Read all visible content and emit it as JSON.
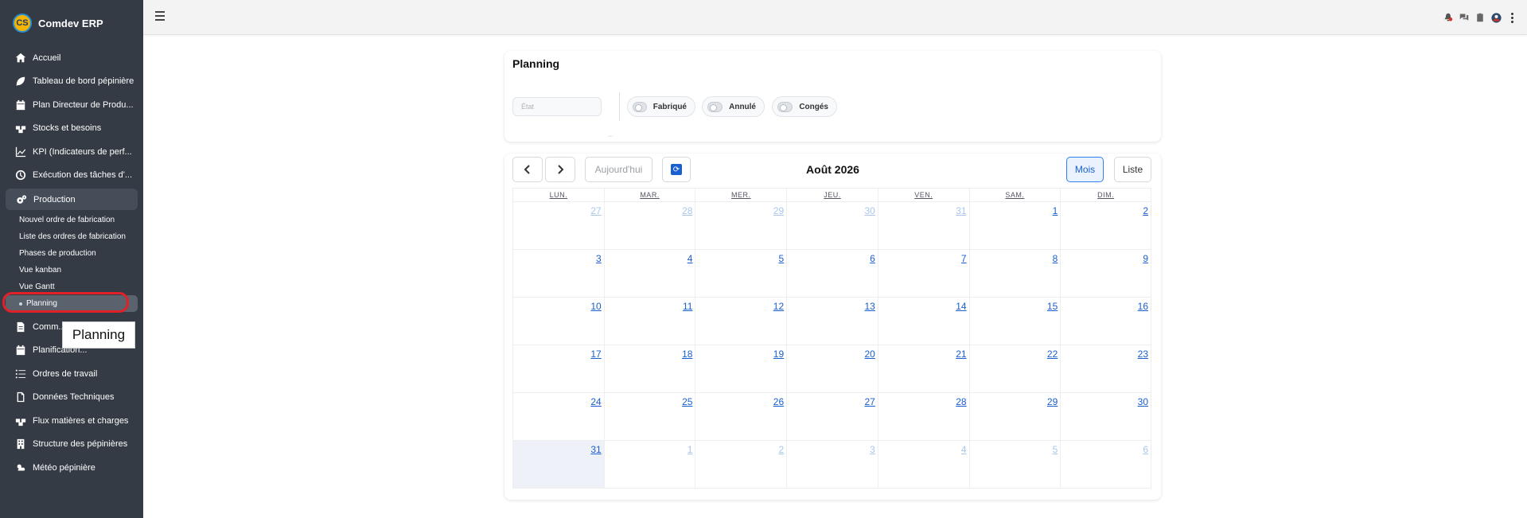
{
  "app": {
    "name": "Comdev ERP",
    "logo_text": "CS"
  },
  "sidebar": {
    "items": [
      {
        "label": "Accueil",
        "icon": "home-icon"
      },
      {
        "label": "Tableau de bord pépinière",
        "icon": "leaf-icon"
      },
      {
        "label": "Plan Directeur de Produ...",
        "icon": "calendar-icon"
      },
      {
        "label": "Stocks et besoins",
        "icon": "boxes-icon"
      },
      {
        "label": "KPI (Indicateurs de perf...",
        "icon": "chart-line-icon"
      },
      {
        "label": "Exécution des tâches d'...",
        "icon": "clock-icon"
      },
      {
        "label": "Production",
        "icon": "cogs-icon"
      }
    ],
    "production_sub": [
      {
        "label": "Nouvel ordre de fabrication"
      },
      {
        "label": "Liste des ordres de fabrication"
      },
      {
        "label": "Phases de production"
      },
      {
        "label": "Vue kanban"
      },
      {
        "label": "Vue Gantt"
      },
      {
        "label": "Planning"
      }
    ],
    "items_after": [
      {
        "label": "Comm...",
        "icon": "file-icon"
      },
      {
        "label": "Planification...",
        "icon": "calendar-icon"
      },
      {
        "label": "Ordres de travail",
        "icon": "list-icon"
      },
      {
        "label": "Données Techniques",
        "icon": "document-icon"
      },
      {
        "label": "Flux matières et charges",
        "icon": "boxes-icon"
      },
      {
        "label": "Structure des pépinières",
        "icon": "building-icon"
      },
      {
        "label": "Météo pépinière",
        "icon": "weather-icon"
      }
    ]
  },
  "tooltip": {
    "text": "Planning"
  },
  "filters": {
    "title": "Planning",
    "etat_placeholder": "État",
    "toggles": [
      {
        "label": "Fabriqué",
        "checked": false
      },
      {
        "label": "Annulé",
        "checked": false
      },
      {
        "label": "Congés",
        "checked": false
      }
    ]
  },
  "calendar": {
    "title": "Août 2026",
    "today_label": "Aujourd'hui",
    "view_month": "Mois",
    "view_list": "Liste",
    "days_of_week": [
      "LUN.",
      "MAR.",
      "MER.",
      "JEU.",
      "VEN.",
      "SAM.",
      "DIM."
    ],
    "weeks": [
      [
        {
          "d": "27",
          "o": true
        },
        {
          "d": "28",
          "o": true
        },
        {
          "d": "29",
          "o": true
        },
        {
          "d": "30",
          "o": true
        },
        {
          "d": "31",
          "o": true
        },
        {
          "d": "1",
          "o": false
        },
        {
          "d": "2",
          "o": false
        }
      ],
      [
        {
          "d": "3",
          "o": false
        },
        {
          "d": "4",
          "o": false
        },
        {
          "d": "5",
          "o": false
        },
        {
          "d": "6",
          "o": false
        },
        {
          "d": "7",
          "o": false
        },
        {
          "d": "8",
          "o": false
        },
        {
          "d": "9",
          "o": false
        }
      ],
      [
        {
          "d": "10",
          "o": false
        },
        {
          "d": "11",
          "o": false
        },
        {
          "d": "12",
          "o": false
        },
        {
          "d": "13",
          "o": false
        },
        {
          "d": "14",
          "o": false
        },
        {
          "d": "15",
          "o": false
        },
        {
          "d": "16",
          "o": false
        }
      ],
      [
        {
          "d": "17",
          "o": false
        },
        {
          "d": "18",
          "o": false
        },
        {
          "d": "19",
          "o": false
        },
        {
          "d": "20",
          "o": false
        },
        {
          "d": "21",
          "o": false
        },
        {
          "d": "22",
          "o": false
        },
        {
          "d": "23",
          "o": false
        }
      ],
      [
        {
          "d": "24",
          "o": false
        },
        {
          "d": "25",
          "o": false
        },
        {
          "d": "26",
          "o": false
        },
        {
          "d": "27",
          "o": false
        },
        {
          "d": "28",
          "o": false
        },
        {
          "d": "29",
          "o": false
        },
        {
          "d": "30",
          "o": false
        }
      ],
      [
        {
          "d": "31",
          "o": false,
          "today": true
        },
        {
          "d": "1",
          "o": true
        },
        {
          "d": "2",
          "o": true
        },
        {
          "d": "3",
          "o": true
        },
        {
          "d": "4",
          "o": true
        },
        {
          "d": "5",
          "o": true
        },
        {
          "d": "6",
          "o": true
        }
      ]
    ]
  },
  "colors": {
    "sidebar_bg": "#343b45",
    "accent": "#1a5fd0",
    "highlight_ring": "#e0212a"
  }
}
